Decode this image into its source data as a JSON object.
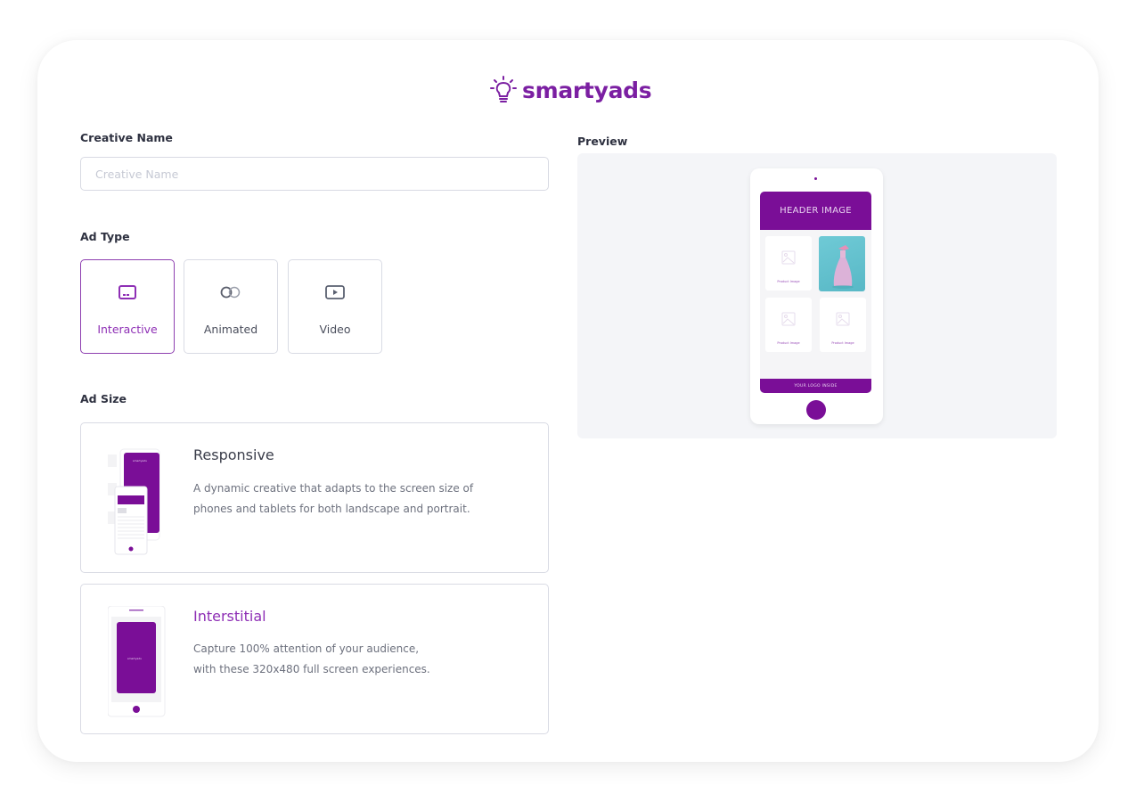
{
  "brand": {
    "name": "smartyads",
    "accent_color": "#7b1fa2"
  },
  "form": {
    "creative_name": {
      "label": "Creative Name",
      "value": "",
      "placeholder": "Creative Name"
    },
    "ad_type": {
      "label": "Ad Type",
      "selected": "Interactive",
      "options": [
        {
          "label": "Interactive",
          "icon": "interactive-icon",
          "active": true
        },
        {
          "label": "Animated",
          "icon": "animated-icon",
          "active": false
        },
        {
          "label": "Video",
          "icon": "video-icon",
          "active": false
        }
      ]
    },
    "ad_size": {
      "label": "Ad Size",
      "options": [
        {
          "title": "Responsive",
          "description_line1": "A dynamic creative that adapts to the screen size of",
          "description_line2": "phones and tablets for both landscape and portrait.",
          "selected": false
        },
        {
          "title": "Interstitial",
          "description_line1": "Capture 100% attention of your audience,",
          "description_line2": "with these 320x480 full screen experiences.",
          "selected": true
        }
      ]
    }
  },
  "preview": {
    "label": "Preview",
    "header_text": "HEADER IMAGE",
    "tiles": [
      {
        "caption": "Product Image",
        "type": "placeholder"
      },
      {
        "caption": "",
        "type": "photo"
      },
      {
        "caption": "Product Image",
        "type": "placeholder"
      },
      {
        "caption": "Product Image",
        "type": "placeholder"
      }
    ],
    "footer_text": "YOUR LOGO INSIDE"
  }
}
